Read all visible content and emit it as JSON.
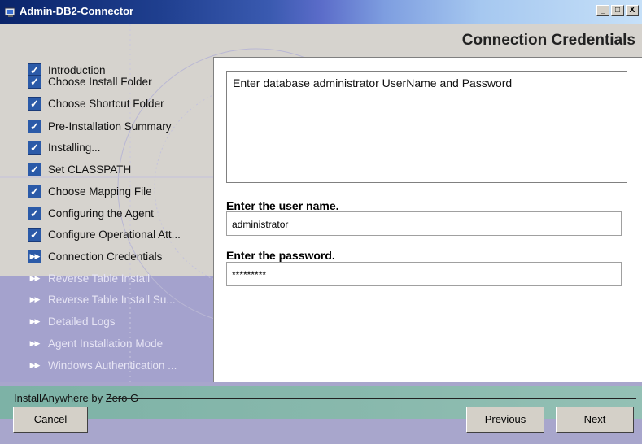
{
  "window": {
    "title": "Admin-DB2-Connector",
    "minimize": "_",
    "maximize": "□",
    "close": "X"
  },
  "header": {
    "page_title": "Connection Credentials"
  },
  "steps": [
    {
      "label": "Introduction",
      "state": "done"
    },
    {
      "label": "Choose Install Folder",
      "state": "done"
    },
    {
      "label": "Choose Shortcut Folder",
      "state": "done"
    },
    {
      "label": "Pre-Installation Summary",
      "state": "done"
    },
    {
      "label": "Installing...",
      "state": "done"
    },
    {
      "label": "Set CLASSPATH",
      "state": "done"
    },
    {
      "label": "Choose Mapping File",
      "state": "done"
    },
    {
      "label": "Configuring the Agent",
      "state": "done"
    },
    {
      "label": "Configure Operational Att...",
      "state": "done"
    },
    {
      "label": "Connection Credentials",
      "state": "current"
    },
    {
      "label": "Reverse Table Install",
      "state": "future"
    },
    {
      "label": "Reverse Table Install Su...",
      "state": "future"
    },
    {
      "label": "Detailed Logs",
      "state": "future"
    },
    {
      "label": "Agent Installation Mode",
      "state": "future"
    },
    {
      "label": "Windows Authentication ...",
      "state": "future"
    }
  ],
  "main": {
    "message": "Enter database administrator UserName and Password",
    "username_label": "Enter the user name.",
    "username_value": "administrator",
    "password_label": "Enter the password.",
    "password_value": "*********"
  },
  "footer": {
    "brand": "InstallAnywhere by Zero G",
    "cancel_label": "Cancel",
    "previous_label": "Previous",
    "next_label": "Next"
  },
  "icons": {
    "done": "check-icon",
    "current": "double-arrow-icon",
    "future": "double-arrow-icon"
  },
  "colors": {
    "title_bar": "#0a246a",
    "step_icon": "#2b5aa8",
    "lower_panel": "#a4a2cd",
    "footer_band": "#7db2a6"
  }
}
